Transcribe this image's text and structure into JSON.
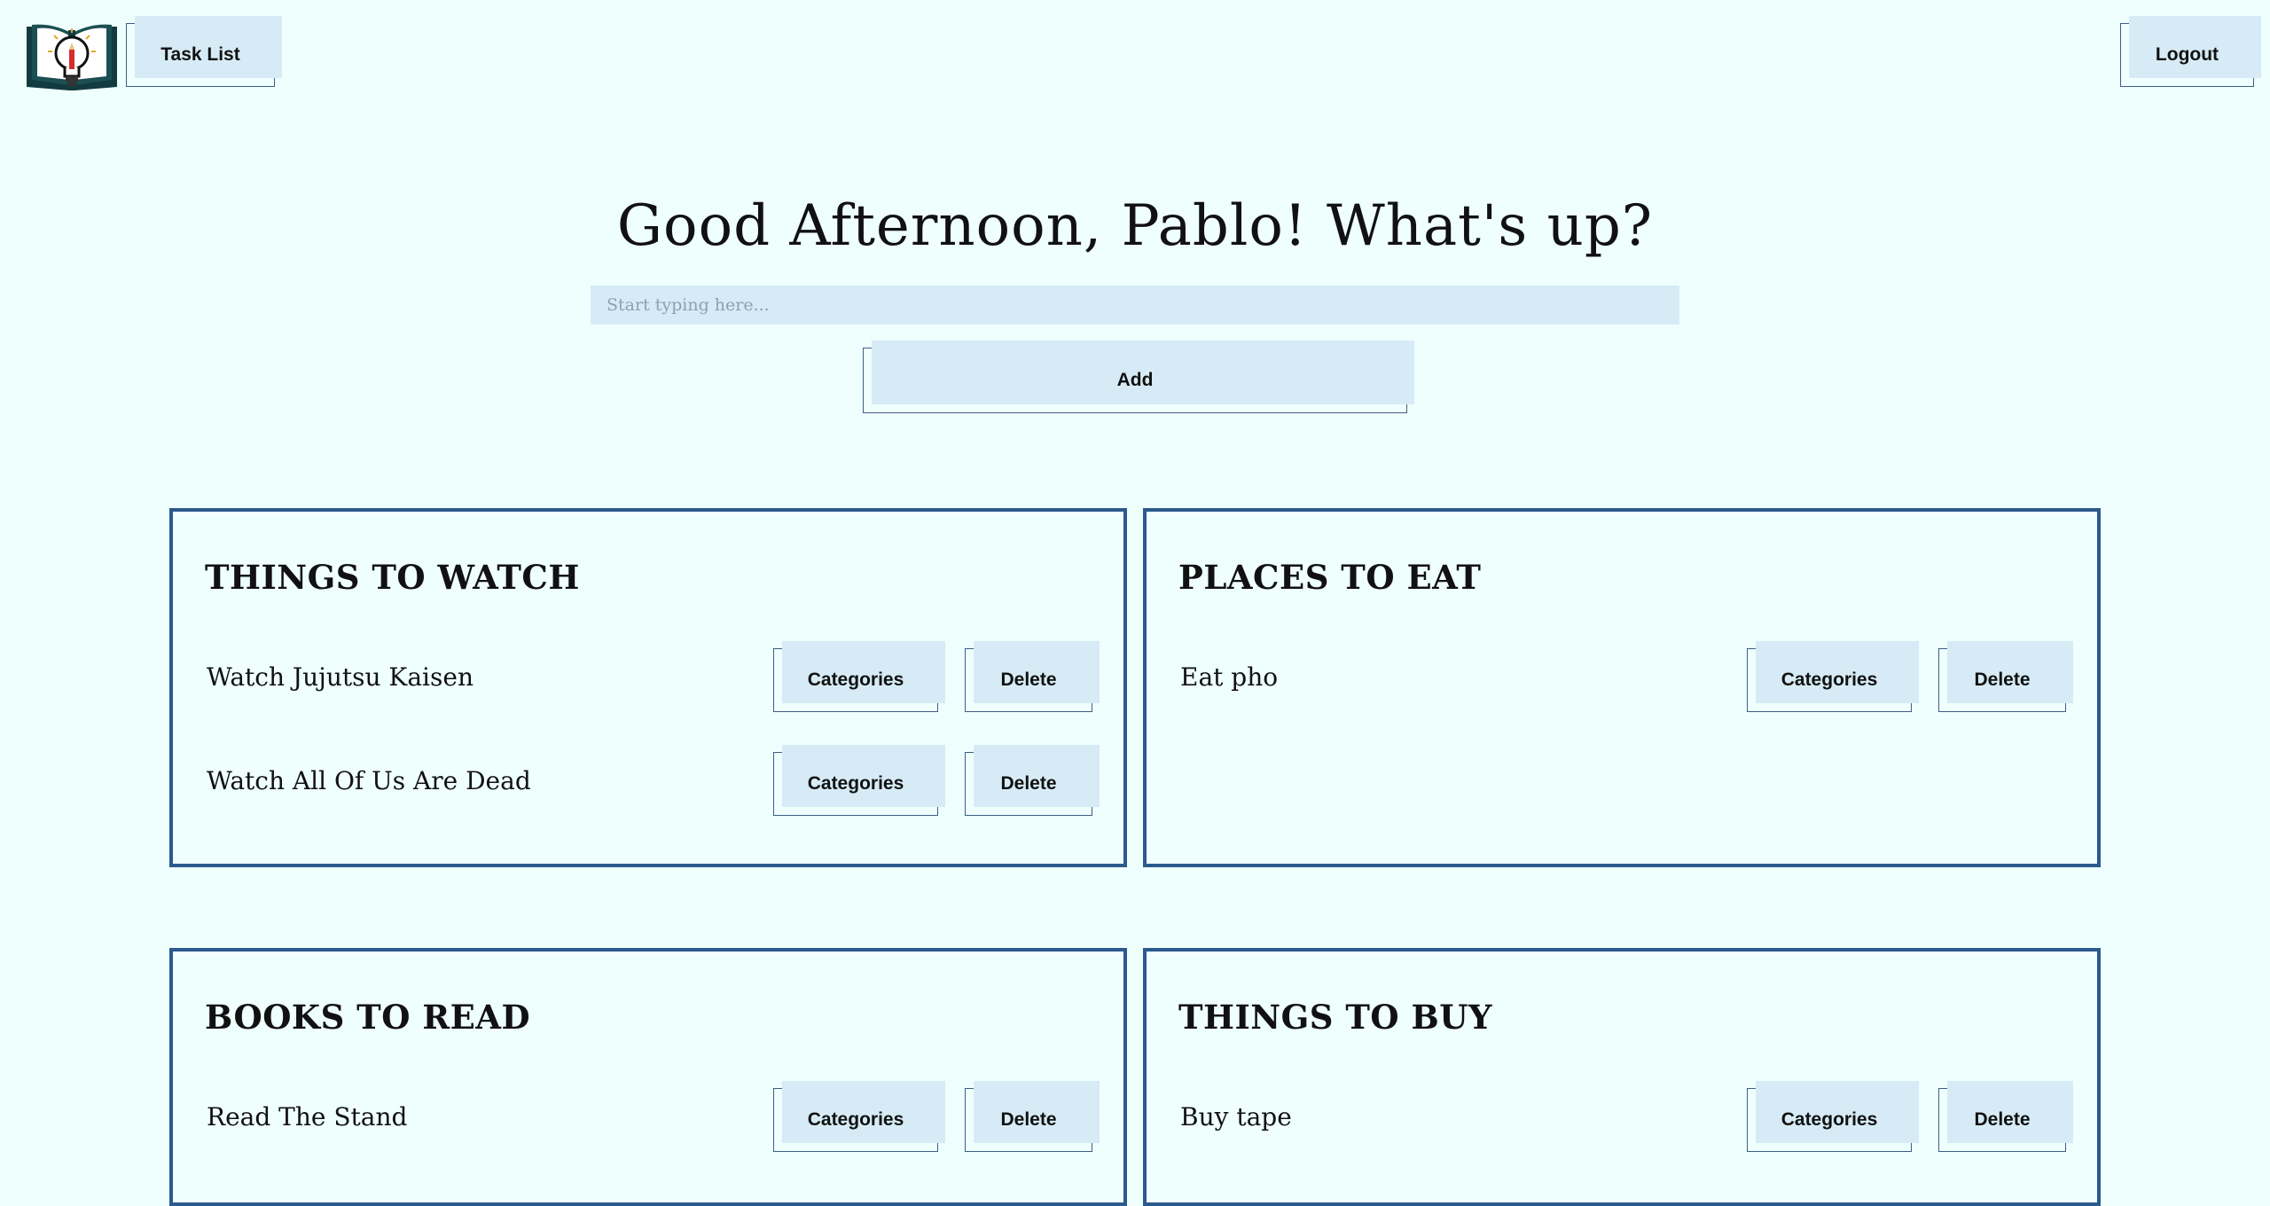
{
  "header": {
    "logo_icon": "open-book-lightbulb-icon",
    "task_list_label": "Task List",
    "logout_label": "Logout"
  },
  "main": {
    "greeting": "Good Afternoon, Pablo! What's up?",
    "input_placeholder": "Start typing here...",
    "input_value": "",
    "add_label": "Add"
  },
  "colors": {
    "background": "#effffe",
    "card_border": "#2b5a8c",
    "button_fill": "#d6ebf5",
    "button_border": "#3d5f86"
  },
  "lists": [
    {
      "title": "THINGS TO WATCH",
      "items": [
        {
          "text": "Watch Jujutsu Kaisen",
          "categories_label": "Categories",
          "delete_label": "Delete"
        },
        {
          "text": "Watch All Of Us Are Dead",
          "categories_label": "Categories",
          "delete_label": "Delete"
        }
      ]
    },
    {
      "title": "PLACES TO EAT",
      "items": [
        {
          "text": "Eat pho",
          "categories_label": "Categories",
          "delete_label": "Delete"
        }
      ]
    },
    {
      "title": "BOOKS TO READ",
      "items": [
        {
          "text": "Read The Stand",
          "categories_label": "Categories",
          "delete_label": "Delete"
        }
      ]
    },
    {
      "title": "THINGS TO BUY",
      "items": [
        {
          "text": "Buy tape",
          "categories_label": "Categories",
          "delete_label": "Delete"
        }
      ]
    }
  ]
}
